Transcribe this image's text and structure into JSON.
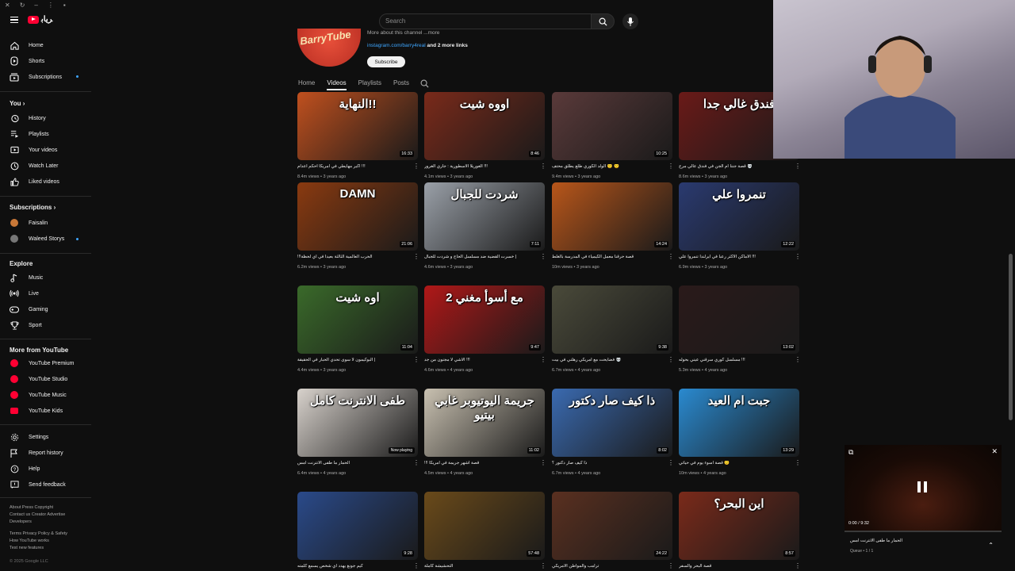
{
  "masthead": {
    "search_placeholder": "Search"
  },
  "sidebar": {
    "main": [
      {
        "label": "Home",
        "icon": "home-icon"
      },
      {
        "label": "Shorts",
        "icon": "shorts-icon"
      },
      {
        "label": "Subscriptions",
        "icon": "subscriptions-icon"
      }
    ],
    "you_header": "You",
    "you": [
      {
        "label": "History",
        "icon": "history-icon"
      },
      {
        "label": "Playlists",
        "icon": "playlists-icon"
      },
      {
        "label": "Your videos",
        "icon": "your-videos-icon"
      },
      {
        "label": "Watch Later",
        "icon": "watch-later-icon"
      },
      {
        "label": "Liked videos",
        "icon": "liked-icon"
      }
    ],
    "subscriptions_header": "Subscriptions",
    "subscriptions": [
      {
        "label": "Faisalin"
      },
      {
        "label": "Waleed Storys"
      }
    ],
    "explore_header": "Explore",
    "explore": [
      {
        "label": "Music",
        "icon": "music-icon"
      },
      {
        "label": "Live",
        "icon": "live-icon"
      },
      {
        "label": "Gaming",
        "icon": "gaming-icon"
      },
      {
        "label": "Sport",
        "icon": "trophy-icon"
      }
    ],
    "more_header": "More from YouTube",
    "more": [
      {
        "label": "YouTube Premium"
      },
      {
        "label": "YouTube Studio"
      },
      {
        "label": "YouTube Music"
      },
      {
        "label": "YouTube Kids"
      }
    ],
    "settings": [
      {
        "label": "Settings",
        "icon": "gear-icon"
      },
      {
        "label": "Report history",
        "icon": "flag-icon"
      },
      {
        "label": "Help",
        "icon": "help-icon"
      },
      {
        "label": "Send feedback",
        "icon": "feedback-icon"
      }
    ],
    "footer1": "About  Press  Copyright",
    "footer2": "Contact us  Creator  Advertise",
    "footer3": "Developers",
    "footer4": "Terms  Privacy  Policy & Safety",
    "footer5": "How YouTube works",
    "footer6": "Test new features",
    "copyright": "© 2025 Google LLC"
  },
  "channel": {
    "avatar_text": "BarryTube",
    "more_text": "More about this channel ...more",
    "link": "instagram.com/barry4real",
    "link_more": "and 2 more links",
    "subscribe": "Subscribe",
    "tabs": [
      "Home",
      "Videos",
      "Playlists",
      "Posts"
    ]
  },
  "videos": [
    {
      "thumb_text": "النهاية!!",
      "duration": "16:33",
      "title": "!!! اكبر مهايطي في امريكا احكم اعدام",
      "meta": "8.4m views • 3 years ago",
      "bg": "#c0501e"
    },
    {
      "thumb_text": "اووه شيت",
      "duration": "8:46",
      "title": "!!! الغوريلا الاسطورية : جاري الغرور",
      "meta": "4.1m views • 3 years ago",
      "bg": "#7a2a1a"
    },
    {
      "thumb_text": "",
      "duration": "10:25",
      "title": "🙂 🙂 الولد الكوري طلع يطلق محتف",
      "meta": "9.4m views • 3 years ago",
      "bg": "#5a3a3a"
    },
    {
      "thumb_text": "فندق غالي جدا",
      "duration": "",
      "title": "💀 قصة جننا ام الجن في فندق عالي مرح",
      "meta": "8.6m views • 3 years ago",
      "bg": "#6a1a18"
    },
    {
      "thumb_text": "DAMN",
      "duration": "21:06",
      "title": "الحرب العالمية الثالثة بعيدا في اي لحظة!!!",
      "meta": "6.2m views • 3 years ago",
      "bg": "#8a3a10"
    },
    {
      "thumb_text": "شردت للجبال",
      "duration": "7:11",
      "title": "| خسرت القضية ضد مسلسل الحاج و شردت للجبال",
      "meta": "4.6m views • 3 years ago",
      "bg": "#9aa0a8"
    },
    {
      "thumb_text": "",
      "duration": "14:24",
      "title": "قصة حرقنا معمل الكيمياء في المدرسة بالغلط",
      "meta": "10m views • 3 years ago",
      "bg": "#b8561a"
    },
    {
      "thumb_text": "تنمروا علي",
      "duration": "12:22",
      "title": "!!! الاماكن الاكثر رعبا في ايرلندا تنمروا علي",
      "meta": "6.9m views • 3 years ago",
      "bg": "#2a3a70"
    },
    {
      "thumb_text": "اوه شيت",
      "duration": "11:04",
      "title": "| البوكيمون لا سوى تحدي الحبار في الحقيقة",
      "meta": "4.4m views • 3 years ago",
      "bg": "#3a6a2a"
    },
    {
      "thumb_text": "مع أسوأ مغني 2",
      "duration": "9:47",
      "title": "!!! الاشي لا مجنون من جد",
      "meta": "4.6m views • 4 years ago",
      "bg": "#b01818"
    },
    {
      "thumb_text": "",
      "duration": "9:38",
      "title": "💀 فضايحت مع امريكي رهلني في بيت",
      "meta": "6.7m views • 4 years ago",
      "bg": "#4a4a3a"
    },
    {
      "thumb_text": "",
      "duration": "13:02",
      "title": "!!! مسلسل كوري سرقني عيني بحوله",
      "meta": "5.3m views • 4 years ago",
      "bg": "#2a1a1a"
    },
    {
      "thumb_text": "طفى الانترنت كامل",
      "duration": "",
      "title": "الحمار ما طفى الانترنت امس",
      "meta": "6.4m views • 4 years ago",
      "bg": "#d8d2cc",
      "now_playing": "Now playing"
    },
    {
      "thumb_text": "جريمة اليوتيوبر غابي بيتيو",
      "duration": "11:02",
      "title": "قصة اشهر جريمة في امريكا !!!",
      "meta": "4.5m views • 4 years ago",
      "bg": "#c8c0b0"
    },
    {
      "thumb_text": "ذا كيف صار دكتور",
      "duration": "8:02",
      "title": "ذا كيف صار دكتور ؟",
      "meta": "6.7m views • 4 years ago",
      "bg": "#3a6ab0"
    },
    {
      "thumb_text": "جبت ام العيد",
      "duration": "13:29",
      "title": "🙂 قصة اسوء يوم في حياتي",
      "meta": "10m views • 4 years ago",
      "bg": "#2a8ad0"
    },
    {
      "thumb_text": "",
      "duration": "9:28",
      "title": "كيم جونغ يهدد اي شخص يسمع كلمته",
      "meta": "",
      "bg": "#2a4a8a"
    },
    {
      "thumb_text": "",
      "duration": "57:48",
      "title": "التحشيشة كاملة",
      "meta": "",
      "bg": "#6a4a1a"
    },
    {
      "thumb_text": "",
      "duration": "24:22",
      "title": "ترامب والمواطن الامريكي",
      "meta": "",
      "bg": "#5a3020"
    },
    {
      "thumb_text": "اين البحر؟",
      "duration": "8:57",
      "title": "قصة البحر والسفر",
      "meta": "",
      "bg": "#7a2a1a"
    }
  ],
  "miniplayer": {
    "time": "0:00 / 9:32",
    "progress": 0,
    "title": "الحمار ما طفى الانترنت امس",
    "queue": "Queue • 1 / 1"
  },
  "colors": {
    "accent": "#ff0033",
    "link": "#3ea6ff",
    "bg": "#0f0f0f"
  }
}
